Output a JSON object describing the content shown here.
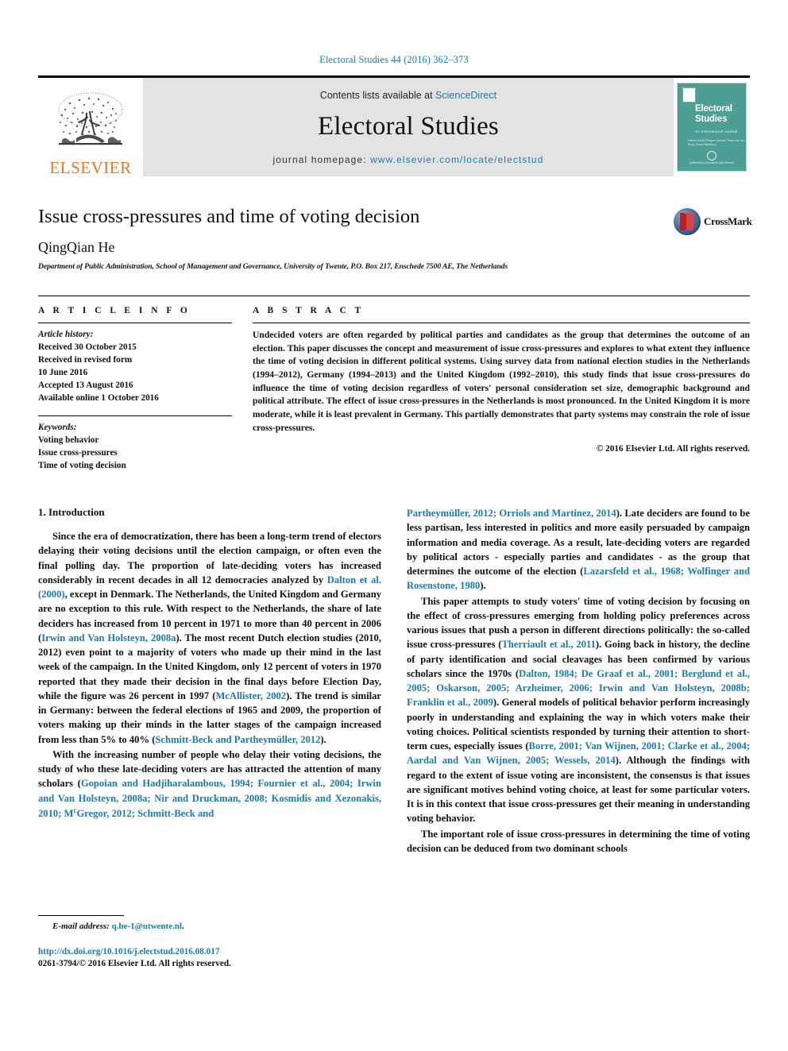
{
  "running_head": "Electoral Studies 44 (2016) 362–373",
  "masthead": {
    "publisher_name": "ELSEVIER",
    "contents_prefix": "Contents lists available at ",
    "contents_link": "ScienceDirect",
    "journal_name": "Electoral Studies",
    "homepage_prefix": "journal homepage: ",
    "homepage_url": "www.elsevier.com/locate/electstud",
    "cover": {
      "title_line1": "Electoral",
      "title_line2": "Studies",
      "subtitle": "An International Journal",
      "editor_line": "Editors\nKevin Deegan-Krause, Peter van der Brug, Susan Banducci",
      "footer": "published in association with\nElsevier"
    }
  },
  "article": {
    "title": "Issue cross-pressures and time of voting decision",
    "author": "QingQian He",
    "affiliation": "Department of Public Administration, School of Management and Governance, University of Twente, P.O. Box 217, Enschede 7500 AE, The Netherlands",
    "crossmark_label": "CrossMark"
  },
  "article_info": {
    "heading": "A R T I C L E   I N F O",
    "history_label": "Article history:",
    "history": [
      "Received 30 October 2015",
      "Received in revised form",
      "10 June 2016",
      "Accepted 13 August 2016",
      "Available online 1 October 2016"
    ],
    "keywords_label": "Keywords:",
    "keywords": [
      "Voting behavior",
      "Issue cross-pressures",
      "Time of voting decision"
    ]
  },
  "abstract": {
    "heading": "A B S T R A C T",
    "text": "Undecided voters are often regarded by political parties and candidates as the group that determines the outcome of an election. This paper discusses the concept and measurement of issue cross-pressures and explores to what extent they influence the time of voting decision in different political systems. Using survey data from national election studies in the Netherlands (1994–2012), Germany (1994–2013) and the United Kingdom (1992–2010), this study finds that issue cross-pressures do influence the time of voting decision regardless of voters' personal consideration set size, demographic background and political attribute. The effect of issue cross-pressures in the Netherlands is most pronounced. In the United Kingdom it is more moderate, while it is least prevalent in Germany. This partially demonstrates that party systems may constrain the role of issue cross-pressures.",
    "copyright": "© 2016 Elsevier Ltd. All rights reserved."
  },
  "introduction": {
    "heading": "1. Introduction",
    "col1_para1_a": "Since the era of democratization, there has been a long-term trend of electors delaying their voting decisions until the election campaign, or often even the final polling day. The proportion of late-deciding voters has increased considerably in recent decades in all 12 democracies analyzed by ",
    "col1_para1_cite1": "Dalton et al. (2000)",
    "col1_para1_b": ", except in Denmark. The Netherlands, the United Kingdom and Germany are no exception to this rule. With respect to the Netherlands, the share of late deciders has increased from 10 percent in 1971 to more than 40 percent in 2006 (",
    "col1_para1_cite2": "Irwin and Van Holsteyn, 2008a",
    "col1_para1_c": "). The most recent Dutch election studies (2010, 2012) even point to a majority of voters who made up their mind in the last week of the campaign. In the United Kingdom, only 12 percent of voters in 1970 reported that they made their decision in the final days before Election Day, while the figure was 26 percent in 1997 (",
    "col1_para1_cite3": "McAllister, 2002",
    "col1_para1_d": "). The trend is similar in Germany: between the federal elections of 1965 and 2009, the proportion of voters making up their minds in the latter stages of the campaign increased from less than 5% to 40% (",
    "col1_para1_cite4": "Schmitt-Beck and Partheymüller, 2012",
    "col1_para1_e": ").",
    "col1_para2_a": "With the increasing number of people who delay their voting decisions, the study of who these late-deciding voters are has attracted the attention of many scholars (",
    "col1_para2_cite1": "Gopoian and Hadjiharalambous, 1994; Fournier et al., 2004; Irwin and Van Holsteyn, 2008a; Nir and Druckman, 2008; Kosmidis and Xezonakis, 2010; M",
    "col1_para2_cite1_sup": "c",
    "col1_para2_cite1_b": "Gregor, 2012; Schmitt-Beck and",
    "col2_para1_cite_a": "Partheymüller, 2012; Orriols and Martinez, 2014",
    "col2_para1_a": "). Late deciders are found to be less partisan, less interested in politics and more easily persuaded by campaign information and media coverage. As a result, late-deciding voters are regarded by political actors - especially parties and candidates - as the group that determines the outcome of the election (",
    "col2_para1_cite_b": "Lazarsfeld et al., 1968; Wolfinger and Rosenstone, 1980",
    "col2_para1_b": ").",
    "col2_para2_a": "This paper attempts to study voters' time of voting decision by focusing on the effect of cross-pressures emerging from holding policy preferences across various issues that push a person in different directions politically: the so-called issue cross-pressures (",
    "col2_para2_cite1": "Therriault et al., 2011",
    "col2_para2_b": "). Going back in history, the decline of party identification and social cleavages has been confirmed by various scholars since the 1970s (",
    "col2_para2_cite2": "Dalton, 1984; De Graaf et al., 2001; Berglund et al., 2005; Oskarson, 2005; Arzheimer, 2006; Irwin and Van Holsteyn, 2008b; Franklin et al., 2009",
    "col2_para2_c": "). General models of political behavior perform increasingly poorly in understanding and explaining the way in which voters make their voting choices. Political scientists responded by turning their attention to short-term cues, especially issues (",
    "col2_para2_cite3": "Borre, 2001; Van Wijnen, 2001; Clarke et al., 2004; Aardal and Van Wijnen, 2005; Wessels, 2014",
    "col2_para2_d": "). Although the findings with regard to the extent of issue voting are inconsistent, the consensus is that issues are significant motives behind voting choice, at least for some particular voters. It is in this context that issue cross-pressures get their meaning in understanding voting behavior.",
    "col2_para3": "The important role of issue cross-pressures in determining the time of voting decision can be deduced from two dominant schools"
  },
  "footer": {
    "email_label": "E-mail address:",
    "email": "q.he-1@utwente.nl",
    "doi": "http://dx.doi.org/10.1016/j.electstud.2016.08.017",
    "issn_line": "0261-3794/© 2016 Elsevier Ltd. All rights reserved."
  },
  "colors": {
    "link": "#1a7bb0",
    "elsevier_orange": "#E87722",
    "cover_teal": "#4d9e93",
    "band_gray": "#e3e3e3"
  }
}
